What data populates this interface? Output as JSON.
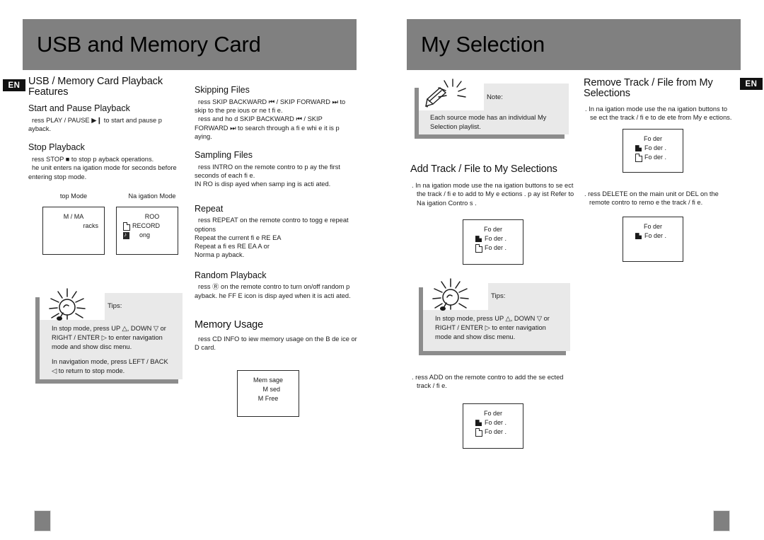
{
  "spread": {
    "left_page": {
      "banner_title": "USB and Memory Card",
      "lang_badge": "EN",
      "page_marker": "",
      "column_1": {
        "heading": "USB / Memory Card Playback Features",
        "sections": [
          {
            "title": "Start and Pause Playback",
            "paragraphs": [
              "ress PLAY / PAUSE  ▶❙ to start and pause p ayback."
            ]
          },
          {
            "title": "Stop Playback",
            "paragraphs": [
              "ress STOP  ■  to stop p ayback operations.",
              "he unit enters na igation mode for    seconds before entering stop mode."
            ]
          }
        ],
        "displays": [
          {
            "caption": "top Mode",
            "lines": [
              {
                "icon": "",
                "text": "M  /  MA",
                "align": "center"
              },
              {
                "icon": "",
                "text": "racks",
                "align": "right"
              }
            ]
          },
          {
            "caption": "Na igation Mode",
            "lines": [
              {
                "icon": "",
                "text": "ROO",
                "align": "center"
              },
              {
                "icon": "doc-icon",
                "text": "RECORD",
                "align": "left"
              },
              {
                "icon": "music-file-icon",
                "text": "ong",
                "align": "left"
              }
            ]
          }
        ],
        "tips": {
          "icon": "lightbulb-icon",
          "label": "Tips:",
          "paragraphs": [
            "In stop mode, press  UP △, DOWN  ▽ or RIGHT / ENTER    ▷  to enter navigation mode and show disc menu.",
            "In navigation mode, press  LEFT / BACK   ◁ to return to stop mode."
          ]
        }
      },
      "column_2": {
        "sections": [
          {
            "title": "Skipping Files",
            "paragraphs": [
              "ress  SKIP BACKWARD   ⏮ / SKIP FORWARD  ⏭ to skip to the pre ious or ne t fi e.",
              "ress and ho d SKIP BACKWARD   ⏮ / SKIP FORWARD  ⏭ to search through a fi e whi e it is p aying."
            ]
          },
          {
            "title": "Sampling Files",
            "paragraphs": [
              "ress INTRO on the remote contro  to p ay the first    seconds of each fi e.",
              "IN RO is disp ayed when samp ing is acti ated."
            ]
          },
          {
            "title": "Repeat",
            "paragraphs": [
              "ress REPEAT on the remote contro  to togg e repeat options",
              "Repeat the current fi e  RE EA",
              "Repeat a   fi es  RE EA  A     or",
              "Norma  p ayback."
            ]
          },
          {
            "title": "Random Playback",
            "paragraphs": [
              "ress  Ⓡ  on the remote contro  to turn on/off random p ayback.  he      FF E icon is disp ayed when it is acti ated."
            ]
          },
          {
            "title": "Memory Usage",
            "paragraphs": [
              "ress CD INFO to  iew memory usage on the      B de ice or  D card."
            ]
          }
        ],
        "display": {
          "lines": [
            {
              "icon": "",
              "text": "Mem   sage",
              "align": "center"
            },
            {
              "icon": "",
              "text": "M   sed",
              "align": "right"
            },
            {
              "icon": "",
              "text": "M Free",
              "align": "center"
            }
          ]
        }
      }
    },
    "right_page": {
      "banner_title": "My Selection",
      "lang_badge": "EN",
      "page_marker": "",
      "column_3": {
        "note": {
          "icon": "pen-writing-icon",
          "label": "Note:",
          "paragraphs": [
            "Each source mode has an individual My Selection playlist."
          ]
        },
        "sections": [
          {
            "title": "Add Track / File to My Selections",
            "paragraphs": [
              ". In na igation mode  use the na igation buttons to se ect the track / fi e to add to My   e ections   .  p ay ist  Refer to Na igation Contro s ."
            ]
          }
        ],
        "displays": [
          {
            "lines": [
              {
                "icon": "",
                "text": "Fo der",
                "align": "center"
              },
              {
                "icon": "folder-icon",
                "text": "Fo der  .",
                "align": "left"
              },
              {
                "icon": "doc-icon",
                "text": "Fo der   .",
                "align": "left"
              }
            ]
          }
        ],
        "tips": {
          "icon": "lightbulb-icon",
          "label": "Tips:",
          "paragraphs": [
            "In stop mode, press  UP △, DOWN  ▽ or RIGHT / ENTER    ▷  to enter  navigation mode and show disc menu."
          ]
        },
        "footer_step": {
          "paragraphs": [
            ".  ress ADD  on the remote contro  to add the se ected track / fi e."
          ],
          "display": {
            "lines": [
              {
                "icon": "",
                "text": "Fo der",
                "align": "center"
              },
              {
                "icon": "folder-icon",
                "text": "Fo der  .",
                "align": "left"
              },
              {
                "icon": "doc-icon",
                "text": "Fo der   .",
                "align": "left"
              }
            ]
          }
        }
      },
      "column_4": {
        "sections": [
          {
            "title": "Remove Track / File from My Selections",
            "paragraphs": [
              ". In na igation mode  use the na igation buttons to se ect the track / fi e to de ete from My  e ections."
            ]
          }
        ],
        "display_1": {
          "lines": [
            {
              "icon": "",
              "text": "Fo der",
              "align": "center"
            },
            {
              "icon": "folder-icon",
              "text": "Fo der  .",
              "align": "left"
            },
            {
              "icon": "doc-icon",
              "text": "Fo der   .",
              "align": "left"
            }
          ]
        },
        "step_2": ".  ress DELETE on the main unit or DEL on the remote contro  to remo e the track / fi e.",
        "display_2": {
          "lines": [
            {
              "icon": "",
              "text": "Fo der",
              "align": "center"
            },
            {
              "icon": "folder-icon",
              "text": "Fo der  .",
              "align": "left"
            }
          ]
        }
      }
    }
  },
  "colors": {
    "banner": "#808080",
    "callout_panel": "#e9e9e9",
    "callout_shadow": "#8c8c8c",
    "badge": "#111111",
    "text": "#1a1a1a"
  }
}
